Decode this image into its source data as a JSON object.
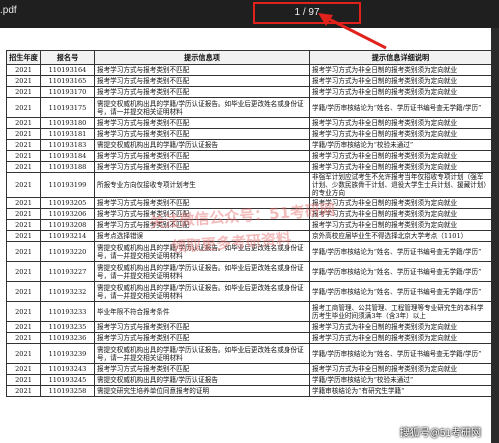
{
  "viewer": {
    "file_name": ".pdf",
    "page_indicator": "1 / 97"
  },
  "table": {
    "headers": [
      "招生年度",
      "报名号",
      "提示信息项",
      "提示信息详细说明"
    ],
    "rows": [
      {
        "year": "2021",
        "id": "110193164",
        "item": "报考学习方式与报考类别不匹配",
        "detail": "报考学习方式为非全日制的报考类别须为定向就业"
      },
      {
        "year": "2021",
        "id": "110193165",
        "item": "报考学习方式与报考类别不匹配",
        "detail": "报考学习方式为非全日制的报考类别须为定向就业"
      },
      {
        "year": "2021",
        "id": "110193170",
        "item": "报考学习方式与报考类别不匹配",
        "detail": "报考学习方式为非全日制的报考类别须为定向就业"
      },
      {
        "year": "2021",
        "id": "110193175",
        "item": "需提交权威机构出具的学籍/学历认证报告。如毕业后更改姓名或身份证号，请一并提交相关证明材料",
        "detail": "学籍/学历审核结论为“姓名、学历证书编号查无学籍/学历”"
      },
      {
        "year": "2021",
        "id": "110193180",
        "item": "报考学习方式与报考类别不匹配",
        "detail": "报考学习方式为非全日制的报考类别须为定向就业"
      },
      {
        "year": "2021",
        "id": "110193181",
        "item": "报考学习方式与报考类别不匹配",
        "detail": "报考学习方式为非全日制的报考类别须为定向就业"
      },
      {
        "year": "2021",
        "id": "110193183",
        "item": "需提交权威机构出具的学籍/学历认证报告",
        "detail": "学籍/学历审核结论为“校验未通过”"
      },
      {
        "year": "2021",
        "id": "110193184",
        "item": "报考学习方式与报考类别不匹配",
        "detail": "报考学习方式为非全日制的报考类别须为定向就业"
      },
      {
        "year": "2021",
        "id": "110193188",
        "item": "报考学习方式与报考类别不匹配",
        "detail": "报考学习方式为非全日制的报考类别须为定向就业"
      },
      {
        "year": "2021",
        "id": "110193199",
        "item": "所报专业方向仅接收专项计划考生",
        "detail": "非强军计划应试考生不允许报考当年仅招收专项计划（强军计划、少数民族骨干计划、退役大学生士兵计划、援藏计划）的专业方向"
      },
      {
        "year": "2021",
        "id": "110193205",
        "item": "报考学习方式与报考类别不匹配",
        "detail": "报考学习方式为非全日制的报考类别须为定向就业"
      },
      {
        "year": "2021",
        "id": "110193206",
        "item": "报考学习方式与报考类别不匹配",
        "detail": "报考学习方式为非全日制的报考类别须为定向就业"
      },
      {
        "year": "2021",
        "id": "110193208",
        "item": "报考学习方式与报考类别不匹配",
        "detail": "报考学习方式为非全日制的报考类别须为定向就业"
      },
      {
        "year": "2021",
        "id": "110193214",
        "item": "报考点选择错误",
        "detail": "京外高校应届毕业生不得选择北京大学考点（1101）"
      },
      {
        "year": "2021",
        "id": "110193220",
        "item": "需提交权威机构出具的学籍/学历认证报告。如毕业后更改姓名或身份证号，请一并提交相关证明材料",
        "detail": "学籍/学历审核结论为“姓名、学历证书编号查无学籍/学历”"
      },
      {
        "year": "2021",
        "id": "110193227",
        "item": "需提交权威机构出具的学籍/学历认证报告。如毕业后更改姓名或身份证号，请一并提交相关证明材料",
        "detail": "学籍/学历审核结论为“姓名、学历证书编号查无学籍/学历”"
      },
      {
        "year": "2021",
        "id": "110193232",
        "item": "需提交权威机构出具的学籍/学历认证报告。如毕业后更改姓名或身份证号，请一并提交相关证明材料",
        "detail": "学籍/学历审核结论为“姓名、学历证书编号查无学籍/学历”"
      },
      {
        "year": "2021",
        "id": "110193233",
        "item": "毕业年限不符合报考条件",
        "detail": "报考工商管理、公共管理、工程管理等专业研究生的本科学历考生毕业时间须满3年（含3年）以上"
      },
      {
        "year": "2021",
        "id": "110193235",
        "item": "报考学习方式与报考类别不匹配",
        "detail": "报考学习方式为非全日制的报考类别须为定向就业"
      },
      {
        "year": "2021",
        "id": "110193236",
        "item": "报考学习方式与报考类别不匹配",
        "detail": "报考学习方式为非全日制的报考类别须为定向就业"
      },
      {
        "year": "2021",
        "id": "110193239",
        "item": "需提交权威机构出具的学籍/学历认证报告。如毕业后更改姓名或身份证号，请一并提交相关证明材料",
        "detail": "学籍/学历审核结论为“姓名、学历证书编号查无学籍/学历”"
      },
      {
        "year": "2021",
        "id": "110193243",
        "item": "报考学习方式与报考类别不匹配",
        "detail": "报考学习方式为非全日制的报考类别须为定向就业"
      },
      {
        "year": "2021",
        "id": "110193245",
        "item": "需提交权威机构出具的学籍/学历认证报告",
        "detail": "学籍/学历审核结论为“校验未通过”"
      },
      {
        "year": "2021",
        "id": "110193258",
        "item": "需提交研究生培养单位同意报考的证明",
        "detail": "学籍审核结论为“有研究生学籍”"
      }
    ]
  },
  "watermark": {
    "line1": "关注微信公众号：51考研网",
    "line2": "领取更多考研资料"
  },
  "corner_logo": "搜狐号@51考研网",
  "colors": {
    "highlight_red": "#e0211c",
    "toolbar_bg": "#1f1f1f"
  }
}
